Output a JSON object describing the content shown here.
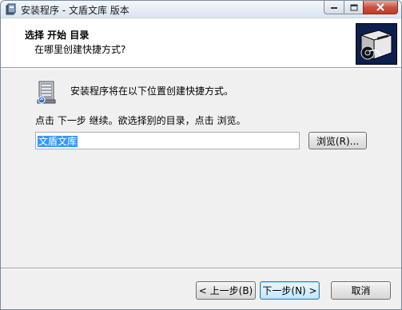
{
  "window": {
    "title": "安装程序 - 文盾文库 版本"
  },
  "header": {
    "title": "选择 开始 目录",
    "subtitle": "在哪里创建快捷方式?"
  },
  "main": {
    "intro": "安装程序将在以下位置创建快捷方式。",
    "instruction": "点击 下一步 继续。欲选择别的目录，点击 浏览。",
    "directory_value": "文盾文库",
    "browse_label": "浏览(R)..."
  },
  "footer": {
    "back_label": "< 上一步(B)",
    "next_label": "下一步(N) >",
    "cancel_label": "取消"
  },
  "colors": {
    "header_image_bg": "#0c1f4f",
    "selection": "#3399ff",
    "close_button": "#c75443"
  },
  "icons": {
    "app": "installer-icon",
    "header": "computer-cd-icon",
    "folder": "program-group-icon"
  }
}
